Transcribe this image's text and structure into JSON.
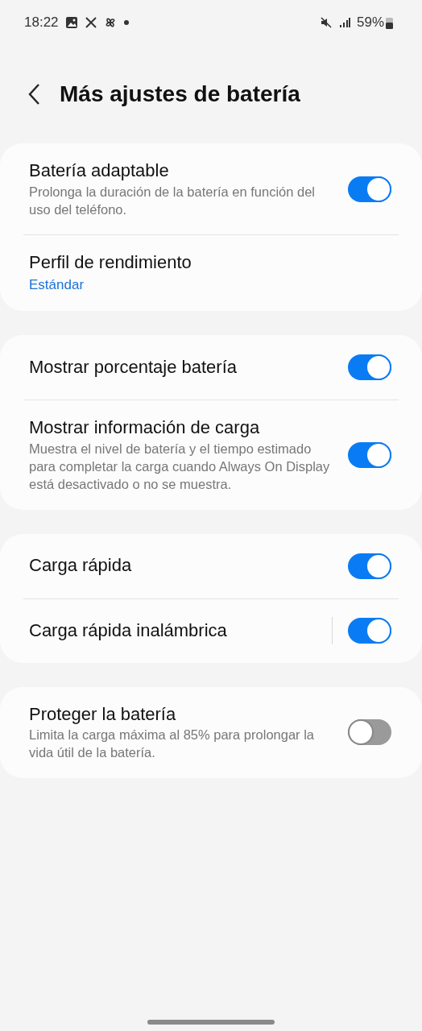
{
  "status_bar": {
    "time": "18:22",
    "battery": "59%"
  },
  "header": {
    "title": "Más ajustes de batería"
  },
  "groups": [
    {
      "items": [
        {
          "kind": "switch",
          "title": "Batería adaptable",
          "subtitle": "Prolonga la duración de la batería en función del uso del teléfono.",
          "on": true
        },
        {
          "kind": "link",
          "title": "Perfil de rendimiento",
          "value": "Estándar"
        }
      ]
    },
    {
      "items": [
        {
          "kind": "switch",
          "title": "Mostrar porcentaje batería",
          "on": true
        },
        {
          "kind": "switch",
          "title": "Mostrar información de carga",
          "subtitle": "Muestra el nivel de batería y el tiempo estimado para completar la carga cuando Always On Display está desactivado o no se muestra.",
          "on": true
        }
      ]
    },
    {
      "items": [
        {
          "kind": "switch",
          "title": "Carga rápida",
          "on": true
        },
        {
          "kind": "split-switch",
          "title": "Carga rápida inalámbrica",
          "on": true
        }
      ]
    },
    {
      "items": [
        {
          "kind": "switch",
          "title": "Proteger la batería",
          "subtitle": "Limita la carga máxima al 85% para prolongar la vida útil de la batería.",
          "on": false
        }
      ]
    }
  ]
}
